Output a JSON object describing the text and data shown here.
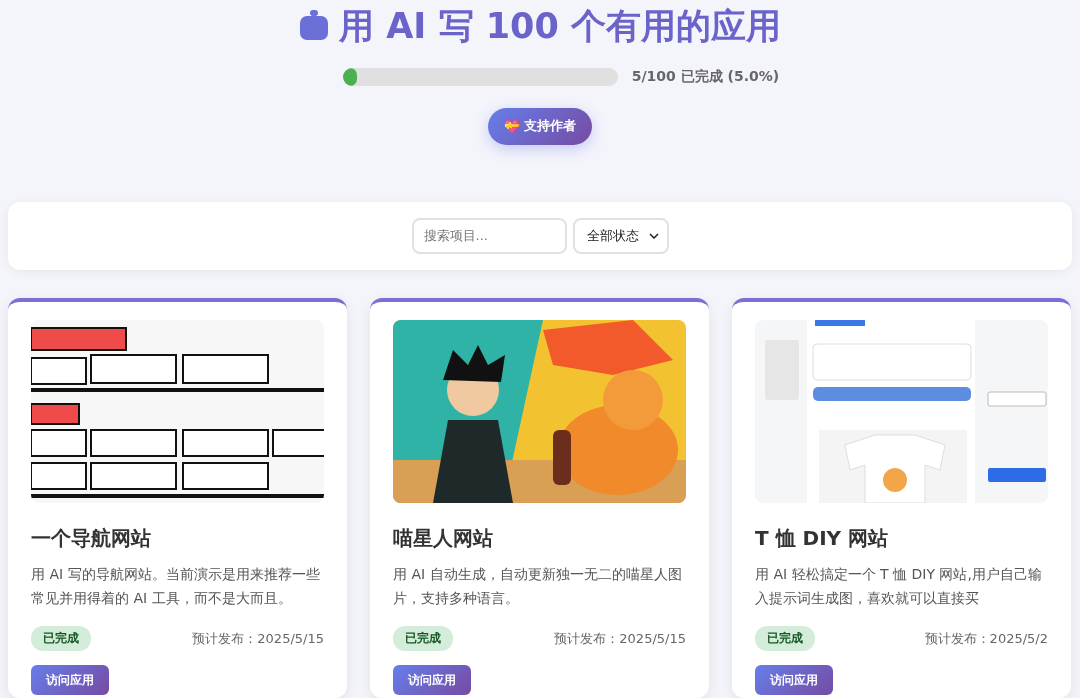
{
  "header": {
    "title": "用 AI 写 100 个有用的应用",
    "progress": {
      "level": 0.05,
      "reading": "5/100 已完成 (5.0%)"
    },
    "support_button": {
      "icon": "💝",
      "label": "支持作者"
    }
  },
  "filters": {
    "search": {
      "placeholder": "搜索项目..."
    },
    "status": {
      "value": "全部状态"
    }
  },
  "cards": [
    {
      "title": "一个导航网站",
      "description": "用 AI 写的导航网站。当前演示是用来推荐一些常见并用得着的 AI 工具，而不是大而且。",
      "status": "已完成",
      "done": true,
      "release": "预计发布：2025/5/15",
      "action": "访问应用"
    },
    {
      "title": "喵星人网站",
      "description": "用 AI 自动生成，自动更新独一无二的喵星人图片，支持多种语言。",
      "status": "已完成",
      "done": true,
      "release": "预计发布：2025/5/15",
      "action": "访问应用"
    },
    {
      "title": "T 恤 DIY 网站",
      "description": "用 AI 轻松搞定一个 T 恤 DIY 网站,用户自己输入提示词生成图，喜欢就可以直接买",
      "status": "已完成",
      "done": true,
      "release": "预计发布：2025/5/2",
      "action": "访问应用"
    }
  ]
}
